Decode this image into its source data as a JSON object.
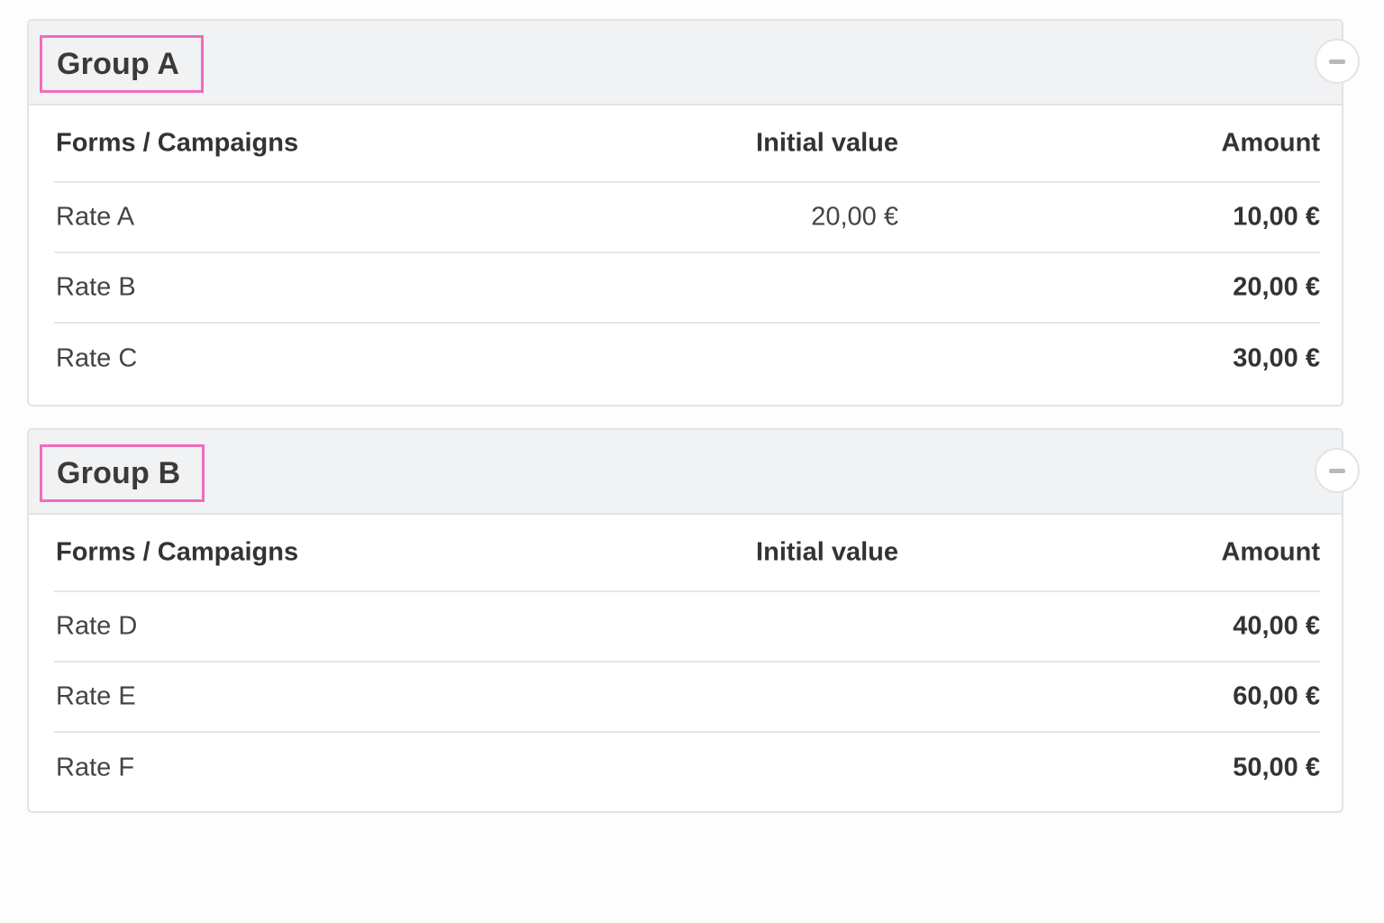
{
  "groups": [
    {
      "title": "Group A",
      "collapse_icon": "minus-icon",
      "columns": {
        "name": "Forms / Campaigns",
        "initial": "Initial value",
        "amount": "Amount"
      },
      "rows": [
        {
          "name": "Rate A",
          "initial": "20,00 €",
          "amount": "10,00 €"
        },
        {
          "name": "Rate B",
          "initial": "",
          "amount": "20,00 €"
        },
        {
          "name": "Rate C",
          "initial": "",
          "amount": "30,00 €"
        }
      ]
    },
    {
      "title": "Group B",
      "collapse_icon": "minus-icon",
      "columns": {
        "name": "Forms / Campaigns",
        "initial": "Initial value",
        "amount": "Amount"
      },
      "rows": [
        {
          "name": "Rate D",
          "initial": "",
          "amount": "40,00 €"
        },
        {
          "name": "Rate E",
          "initial": "",
          "amount": "60,00 €"
        },
        {
          "name": "Rate F",
          "initial": "",
          "amount": "50,00 €"
        }
      ]
    }
  ],
  "colors": {
    "highlight_border": "#f06cbc",
    "header_background": "#f1f2f4",
    "panel_border": "#e2e3e5"
  }
}
